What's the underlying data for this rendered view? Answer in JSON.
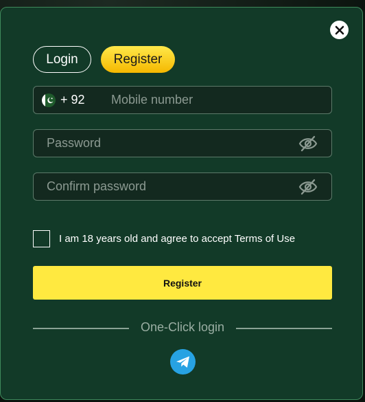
{
  "tabs": {
    "login_label": "Login",
    "register_label": "Register"
  },
  "phone": {
    "country_code": "+ 92",
    "placeholder": "Mobile number",
    "flag_icon": "pakistan-flag-icon"
  },
  "password": {
    "placeholder": "Password"
  },
  "confirm_password": {
    "placeholder": "Confirm password"
  },
  "terms": {
    "text": "I am 18 years old and agree to accept Terms of Use",
    "checked": false
  },
  "submit": {
    "label": "Register"
  },
  "divider": {
    "text": "One-Click login"
  },
  "icons": {
    "close": "close-icon",
    "eye": "eye-off-icon",
    "telegram": "telegram-icon"
  },
  "colors": {
    "modal_bg": "#123a28",
    "accent_yellow": "#ffe940",
    "telegram_blue": "#27a2e3"
  }
}
